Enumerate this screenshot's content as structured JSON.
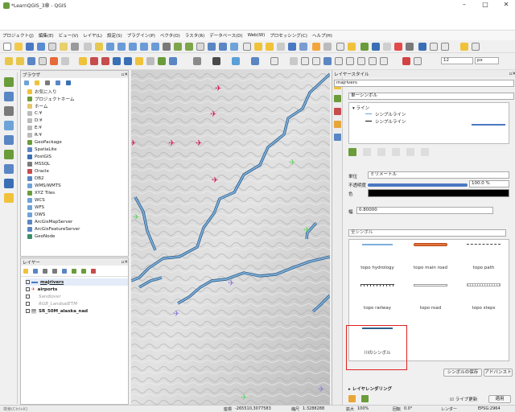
{
  "window": {
    "title": "*LearnQGIS_3章 - QGIS",
    "minimize": "–",
    "maximize": "□",
    "close": "✕"
  },
  "menu": [
    "プロジェクト(J)",
    "編集(E)",
    "ビュー(V)",
    "レイヤ(L)",
    "設定(S)",
    "プラグイン(P)",
    "ベクタ(O)",
    "ラスタ(R)",
    "データベース(D)",
    "Web(W)",
    "プロセッシング(C)",
    "ヘルプ(H)"
  ],
  "toolbar": {
    "font_size_value": "12",
    "font_unit": "px"
  },
  "browser": {
    "title": "ブラウザ",
    "items": [
      "お気に入り",
      "プロジェクトホーム",
      "ホーム",
      "C:¥",
      "D:¥",
      "E:¥",
      "R:¥",
      "GeoPackage",
      "SpatiaLite",
      "PostGIS",
      "MSSQL",
      "Oracle",
      "DB2",
      "WMS/WMTS",
      "XYZ Tiles",
      "WCS",
      "WFS",
      "OWS",
      "ArcGisMapServer",
      "ArcGisFeatureServer",
      "GeoNode"
    ]
  },
  "layers": {
    "title": "レイヤー",
    "items": [
      "majrivers",
      "airports",
      "Sandlover",
      "RGB_LandsatETM",
      "SR_50M_alaska_nad"
    ]
  },
  "style_panel": {
    "title": "レイヤースタイル",
    "layer_select": "majrivers",
    "renderer": "単一シンボル",
    "tree": {
      "root": "ライン",
      "child1": "シンプルライン",
      "child2": "シンプルライン"
    },
    "unit_label": "単位",
    "unit_value": "ミリメートル",
    "opacity_label": "不透明度",
    "opacity_value": "100.0 %",
    "color_label": "色",
    "width_label": "幅",
    "width_value": "0.80000",
    "search_placeholder": "全シンボル",
    "symbols": [
      "topo hydrology",
      "topo main road",
      "topo path",
      "topo railway",
      "topo road",
      "topo steps",
      "川のシンボル"
    ],
    "save_symbol": "シンボルの保存",
    "advanced": "アドバンスト",
    "layer_rendering": "レイヤレンダリング",
    "live_update": "ライブ更新",
    "apply": "適用"
  },
  "statusbar": {
    "search_placeholder": "検索(Ctrl+K)",
    "coord_label": "座標",
    "coord_value": "-265510,3077583",
    "scale_label": "縮尺",
    "scale_value": "1:3288288",
    "magnifier_label": "拡大",
    "magnifier_value": "100%",
    "rotation_label": "回転",
    "rotation_value": "0.0°",
    "render_label": "レンダー",
    "crs": "EPSG:2964"
  }
}
